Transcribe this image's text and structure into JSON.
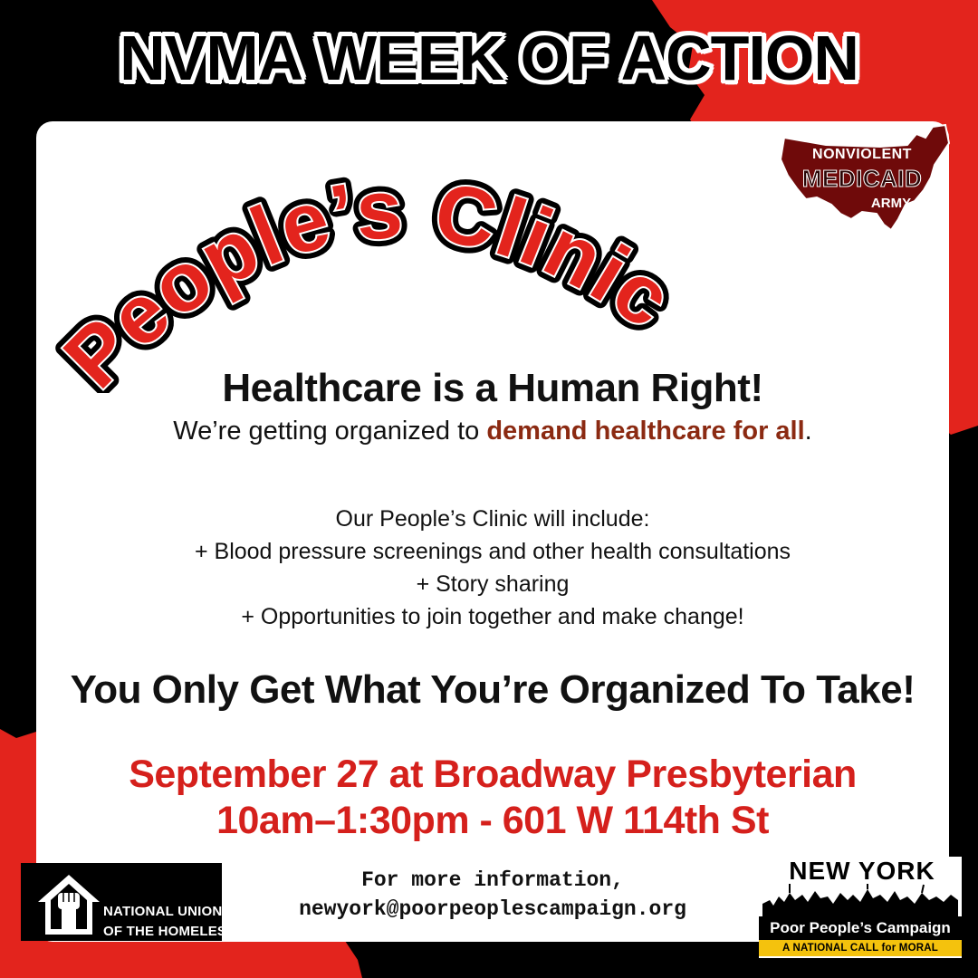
{
  "colors": {
    "background": "#000000",
    "red_accent": "#e3241d",
    "event_red": "#d5201c",
    "emphasis_brown": "#8b2a12",
    "panel": "#ffffff"
  },
  "header": {
    "title": "NVMA WEEK OF ACTION"
  },
  "poster": {
    "arc_title": "People’s Clinic",
    "tagline": "Healthcare is a Human Right!",
    "subline_pre": "We’re getting organized to ",
    "subline_emph": "demand healthcare for all",
    "subline_post": ".",
    "list_intro": "Our People’s Clinic will include:",
    "list_items": [
      "+ Blood pressure screenings and other health consultations",
      "+ Story sharing",
      "+ Opportunities to join together and make change!"
    ],
    "slogan": "You Only Get What You’re Organized To Take!",
    "event_line1": "September 27 at Broadway Presbyterian",
    "event_line2": "10am–1:30pm - 601 W 114th St",
    "contact_line1": "For more information,",
    "contact_line2": "newyork@poorpeoplescampaign.org"
  },
  "logos": {
    "nvma": {
      "line1": "NONVIOLENT",
      "line2": "MEDICAID",
      "line3": "ARMY",
      "icon": "us-map-icon"
    },
    "nuh": {
      "line1": "NATIONAL UNION",
      "line2": "OF THE HOMELESS",
      "icon": "raised-fist-house-icon"
    },
    "ppc": {
      "line1": "NEW YORK",
      "line2": "Poor People’s Campaign",
      "line3": "A NATIONAL CALL for MORAL REVIVAL",
      "icon": "crowd-silhouette-icon"
    }
  }
}
